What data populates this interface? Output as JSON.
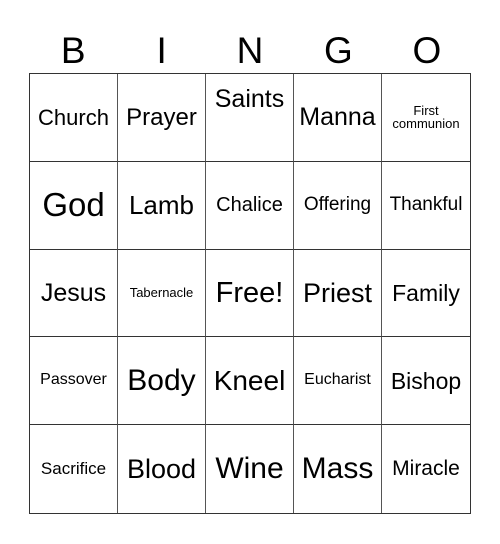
{
  "header": [
    "B",
    "I",
    "N",
    "G",
    "O"
  ],
  "cells": [
    {
      "text": "Church",
      "size": "s22"
    },
    {
      "text": "Prayer",
      "size": "s24"
    },
    {
      "text": "Saints",
      "size": "s25",
      "top": true
    },
    {
      "text": "Manna",
      "size": "s25"
    },
    {
      "text": "First communion",
      "size": "s13"
    },
    {
      "text": "God",
      "size": "s33"
    },
    {
      "text": "Lamb",
      "size": "s26"
    },
    {
      "text": "Chalice",
      "size": "s20"
    },
    {
      "text": "Offering",
      "size": "s19"
    },
    {
      "text": "Thankful",
      "size": "s19"
    },
    {
      "text": "Jesus",
      "size": "s25"
    },
    {
      "text": "Tabernacle",
      "size": "s13"
    },
    {
      "text": "Free!",
      "size": "s29"
    },
    {
      "text": "Priest",
      "size": "s27"
    },
    {
      "text": "Family",
      "size": "s23"
    },
    {
      "text": "Passover",
      "size": "s16"
    },
    {
      "text": "Body",
      "size": "s30"
    },
    {
      "text": "Kneel",
      "size": "s28"
    },
    {
      "text": "Eucharist",
      "size": "s16"
    },
    {
      "text": "Bishop",
      "size": "s23"
    },
    {
      "text": "Sacrifice",
      "size": "s17"
    },
    {
      "text": "Blood",
      "size": "s27"
    },
    {
      "text": "Wine",
      "size": "s30"
    },
    {
      "text": "Mass",
      "size": "s30"
    },
    {
      "text": "Miracle",
      "size": "s21"
    }
  ]
}
